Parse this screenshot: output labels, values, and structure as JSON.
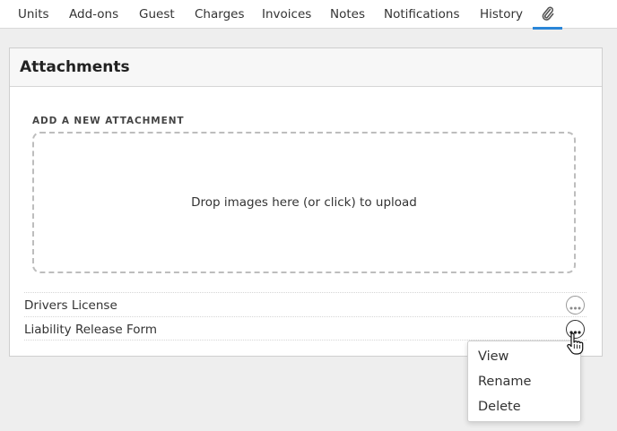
{
  "tabs": [
    {
      "label": "Units"
    },
    {
      "label": "Add-ons"
    },
    {
      "label": "Guest"
    },
    {
      "label": "Charges"
    },
    {
      "label": "Invoices"
    },
    {
      "label": "Notes"
    },
    {
      "label": "Notifications"
    },
    {
      "label": "History"
    }
  ],
  "active_tab_icon": "paperclip-icon",
  "accent_color": "#2a86d8",
  "panel": {
    "title": "Attachments",
    "section_label": "ADD A NEW ATTACHMENT",
    "dropzone_text": "Drop images here (or click) to upload"
  },
  "attachments": [
    {
      "name": "Drivers License"
    },
    {
      "name": "Liability Release Form"
    }
  ],
  "context_menu": {
    "items": [
      {
        "label": "View"
      },
      {
        "label": "Rename"
      },
      {
        "label": "Delete"
      }
    ]
  }
}
